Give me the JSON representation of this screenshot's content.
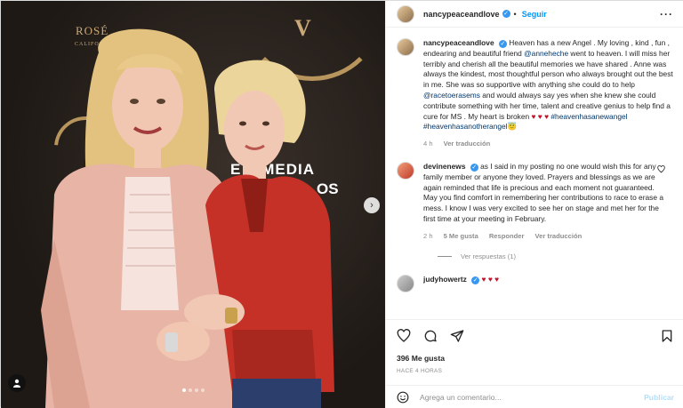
{
  "post": {
    "author": "nancypeaceandlove",
    "follow_label": "Seguir",
    "more_label": "···"
  },
  "photo": {
    "logo_top": "ROSÉ",
    "logo_sub": "CALIFORN",
    "banner_v": "V",
    "banner_text_1": "E    MEDIA",
    "banner_text_2": "OS",
    "next_arrow": "›",
    "tag_icon": "person-icon"
  },
  "caption": {
    "user": "nancypeaceandlove",
    "text_1": "Heaven has a new Angel . My loving , kind , fun , endearing and beautiful friend ",
    "mention_1": "@anneheche",
    "text_2": " went to heaven. I will miss her terribly and cherish all the beautiful memories we have shared . Anne was always the kindest, most thoughtful person who always brought out the best in me. She was so supportive with anything she could do to help ",
    "mention_2": "@racetoerasems",
    "text_3": " and would always say yes when she knew she could contribute something with her time, talent and creative genius to help find a cure for MS . My heart is broken ",
    "hearts": "♥ ♥ ♥",
    "tag_1": "#heavenhasanewangel",
    "tag_2": "#heavenhasanotherangel",
    "emoji": "😇",
    "time": "4 h",
    "translate": "Ver traducción"
  },
  "comment": {
    "user": "devinenews",
    "text": "as I said in my posting no one would wish this for any family member or anyone they loved. Prayers and blessings as we are again reminded that life is precious and each moment not guaranteed. May you find comfort in remembering her contributions to race to erase a mess. I know I was very excited to see her on stage and met her for the first time at your meeting in February.",
    "time": "2 h",
    "likes": "5 Me gusta",
    "reply": "Responder",
    "translate": "Ver traducción",
    "view_replies": "Ver respuestas (1)"
  },
  "partial_comment": {
    "user": "judyhowertz",
    "hearts": "♥ ♥ ♥"
  },
  "actions": {
    "likes": "396 Me gusta",
    "time": "HACE 4 HORAS"
  },
  "compose": {
    "placeholder": "Agrega un comentario...",
    "publish": "Publicar"
  }
}
